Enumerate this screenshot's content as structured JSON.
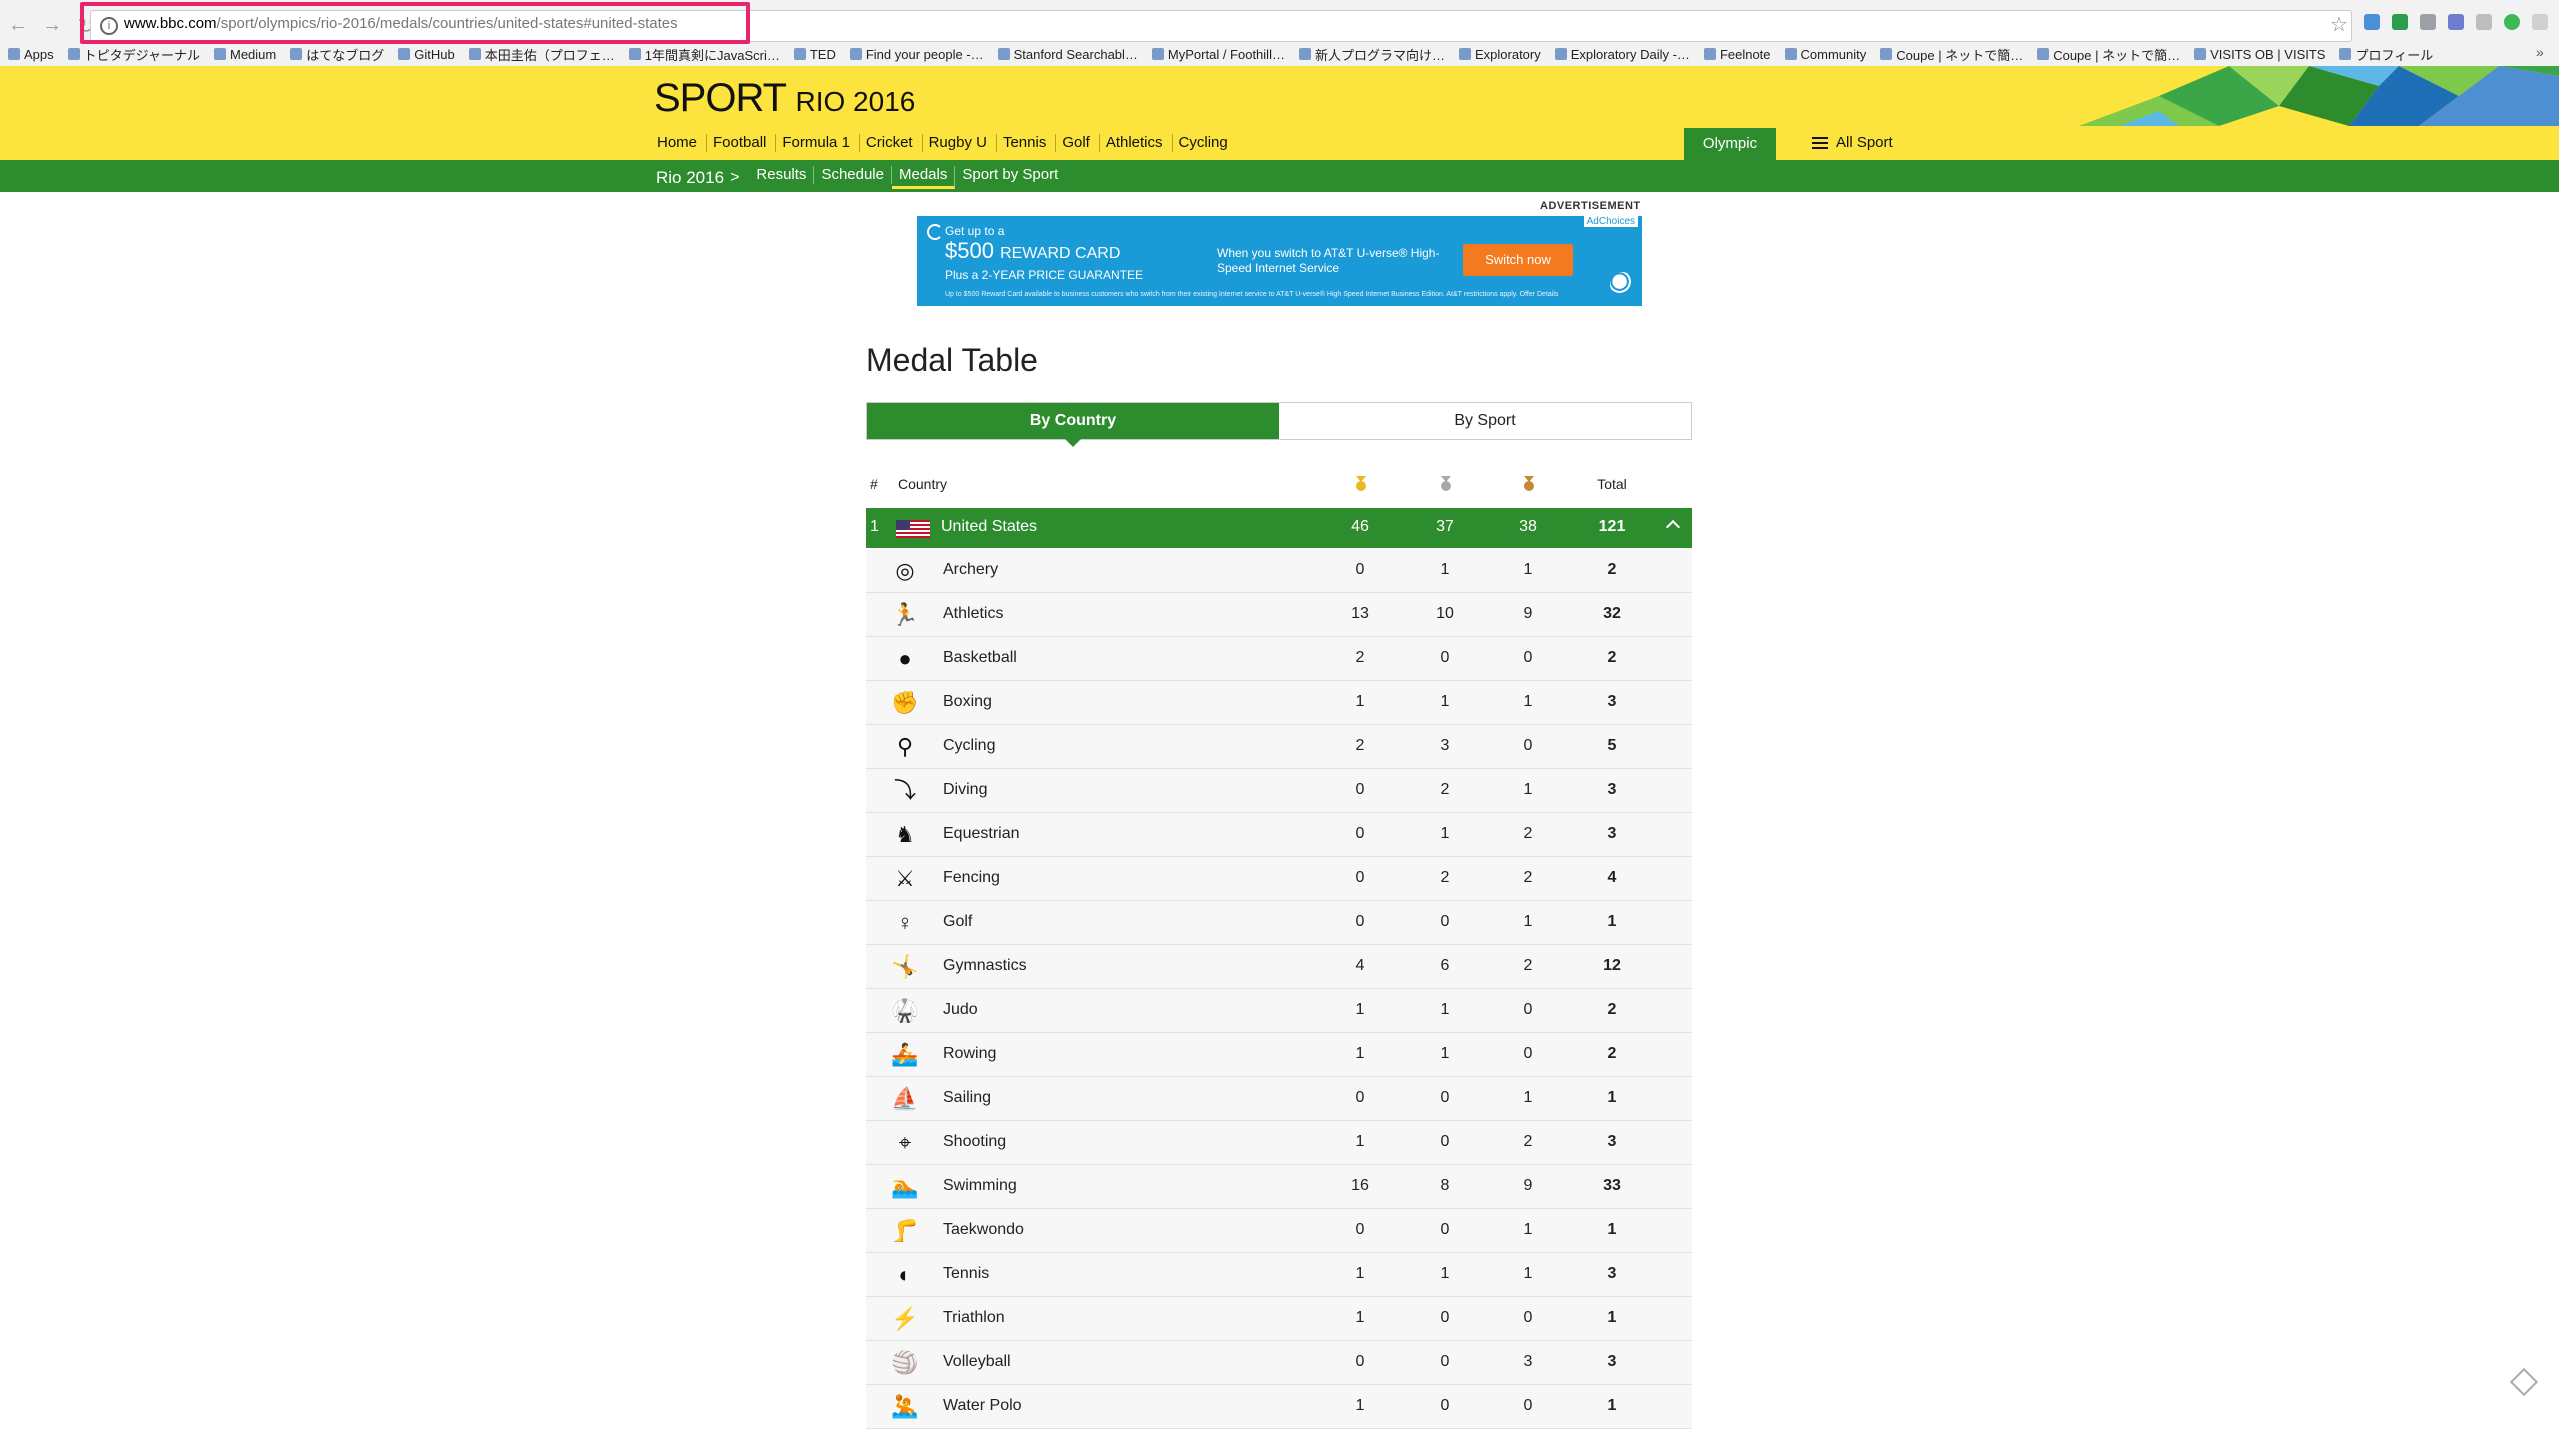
{
  "browser": {
    "url_domain": "www.bbc.com",
    "url_path": "/sport/olympics/rio-2016/medals/countries/united-states#united-states",
    "bookmarks": [
      "Apps",
      "トピタデジャーナル",
      "Medium",
      "はてなブログ",
      "GitHub",
      "本田圭佑（プロフェ…",
      "1年間真剣にJavaScri…",
      "TED",
      "Find your people -…",
      "Stanford Searchabl…",
      "MyPortal / Foothill…",
      "新人プログラマ向け…",
      "Exploratory",
      "Exploratory Daily -…",
      "Feelnote",
      "Community",
      "Coupe | ネットで簡…",
      "Coupe | ネットで簡…",
      "VISITS OB | VISITS",
      "プロフィール"
    ],
    "bookmarks_more": "»"
  },
  "header": {
    "sport": "SPORT",
    "event": "RIO 2016",
    "nav": [
      "Home",
      "Football",
      "Formula 1",
      "Cricket",
      "Rugby U",
      "Tennis",
      "Golf",
      "Athletics",
      "Cycling"
    ],
    "olympic_games": "Olympic Games",
    "all_sport": "All Sport"
  },
  "subnav": {
    "root": "Rio 2016",
    "arrow": ">",
    "items": [
      "Results",
      "Schedule",
      "Medals",
      "Sport by Sport"
    ],
    "active": "Medals"
  },
  "ad": {
    "label": "ADVERTISEMENT",
    "adchoices": "AdChoices",
    "line1": "Get up to a",
    "amount": "$500",
    "amount_suffix": "REWARD CARD",
    "line3": "Plus a 2-YEAR PRICE GUARANTEE",
    "body": "When you switch to AT&T U-verse® High-Speed Internet Service",
    "button": "Switch now",
    "fine": "Up to $500 Reward Card available to business customers who switch from their existing Internet service to AT&T U-verse® High Speed Internet Business Edition. At&T restrictions apply. Offer Details"
  },
  "medal_table": {
    "title": "Medal Table",
    "tabs": [
      "By Country",
      "By Sport"
    ],
    "active_tab": "By Country",
    "columns": {
      "rank": "#",
      "country": "Country",
      "total": "Total"
    },
    "medal_colors": {
      "gold": "#e8b923",
      "silver": "#a8a8a8",
      "bronze": "#c7873a"
    },
    "country": {
      "rank": "1",
      "name": "United States",
      "gold": "46",
      "silver": "37",
      "bronze": "38",
      "total": "121"
    },
    "sports": [
      {
        "name": "Archery",
        "icon": "archery-icon",
        "glyph": "◎",
        "gold": "0",
        "silver": "1",
        "bronze": "1",
        "total": "2"
      },
      {
        "name": "Athletics",
        "icon": "athletics-icon",
        "glyph": "🏃",
        "gold": "13",
        "silver": "10",
        "bronze": "9",
        "total": "32"
      },
      {
        "name": "Basketball",
        "icon": "basketball-icon",
        "glyph": "●",
        "gold": "2",
        "silver": "0",
        "bronze": "0",
        "total": "2"
      },
      {
        "name": "Boxing",
        "icon": "boxing-icon",
        "glyph": "✊",
        "gold": "1",
        "silver": "1",
        "bronze": "1",
        "total": "3"
      },
      {
        "name": "Cycling",
        "icon": "cycling-icon",
        "glyph": "⚲",
        "gold": "2",
        "silver": "3",
        "bronze": "0",
        "total": "5"
      },
      {
        "name": "Diving",
        "icon": "diving-icon",
        "glyph": "⤵",
        "gold": "0",
        "silver": "2",
        "bronze": "1",
        "total": "3"
      },
      {
        "name": "Equestrian",
        "icon": "equestrian-icon",
        "glyph": "♞",
        "gold": "0",
        "silver": "1",
        "bronze": "2",
        "total": "3"
      },
      {
        "name": "Fencing",
        "icon": "fencing-icon",
        "glyph": "⚔",
        "gold": "0",
        "silver": "2",
        "bronze": "2",
        "total": "4"
      },
      {
        "name": "Golf",
        "icon": "golf-icon",
        "glyph": "♀",
        "gold": "0",
        "silver": "0",
        "bronze": "1",
        "total": "1"
      },
      {
        "name": "Gymnastics",
        "icon": "gymnastics-icon",
        "glyph": "🤸",
        "gold": "4",
        "silver": "6",
        "bronze": "2",
        "total": "12"
      },
      {
        "name": "Judo",
        "icon": "judo-icon",
        "glyph": "🥋",
        "gold": "1",
        "silver": "1",
        "bronze": "0",
        "total": "2"
      },
      {
        "name": "Rowing",
        "icon": "rowing-icon",
        "glyph": "🚣",
        "gold": "1",
        "silver": "1",
        "bronze": "0",
        "total": "2"
      },
      {
        "name": "Sailing",
        "icon": "sailing-icon",
        "glyph": "⛵",
        "gold": "0",
        "silver": "0",
        "bronze": "1",
        "total": "1"
      },
      {
        "name": "Shooting",
        "icon": "shooting-icon",
        "glyph": "⌖",
        "gold": "1",
        "silver": "0",
        "bronze": "2",
        "total": "3"
      },
      {
        "name": "Swimming",
        "icon": "swimming-icon",
        "glyph": "🏊",
        "gold": "16",
        "silver": "8",
        "bronze": "9",
        "total": "33"
      },
      {
        "name": "Taekwondo",
        "icon": "taekwondo-icon",
        "glyph": "🦵",
        "gold": "0",
        "silver": "0",
        "bronze": "1",
        "total": "1"
      },
      {
        "name": "Tennis",
        "icon": "tennis-icon",
        "glyph": "◐",
        "gold": "1",
        "silver": "1",
        "bronze": "1",
        "total": "3"
      },
      {
        "name": "Triathlon",
        "icon": "triathlon-icon",
        "glyph": "⚡",
        "gold": "1",
        "silver": "0",
        "bronze": "0",
        "total": "1"
      },
      {
        "name": "Volleyball",
        "icon": "volleyball-icon",
        "glyph": "🏐",
        "gold": "0",
        "silver": "0",
        "bronze": "3",
        "total": "3"
      },
      {
        "name": "Water Polo",
        "icon": "water-polo-icon",
        "glyph": "🤽",
        "gold": "1",
        "silver": "0",
        "bronze": "0",
        "total": "1"
      }
    ]
  }
}
